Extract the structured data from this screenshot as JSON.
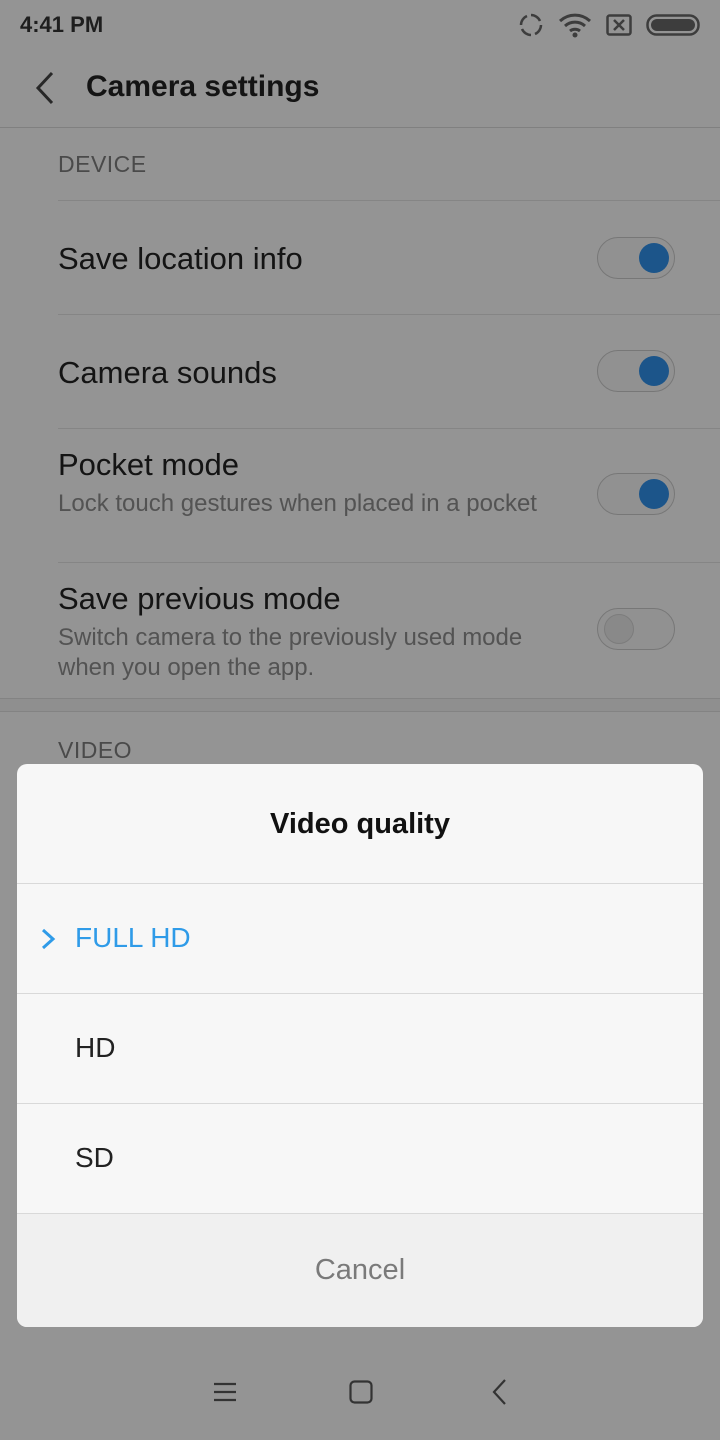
{
  "status_bar": {
    "time": "4:41 PM"
  },
  "app_bar": {
    "title": "Camera settings"
  },
  "device_section": {
    "header": "DEVICE",
    "items": [
      {
        "title": "Save location info",
        "subtitle": "",
        "enabled": true
      },
      {
        "title": "Camera sounds",
        "subtitle": "",
        "enabled": true
      },
      {
        "title": "Pocket mode",
        "subtitle": "Lock touch gestures when placed in a pocket",
        "enabled": true
      },
      {
        "title": "Save previous mode",
        "subtitle": "Switch camera to the previously used mode when you open the app.",
        "enabled": false
      }
    ]
  },
  "video_section": {
    "header": "VIDEO"
  },
  "dialog": {
    "title": "Video quality",
    "options": [
      {
        "label": "FULL HD",
        "selected": true
      },
      {
        "label": "HD",
        "selected": false
      },
      {
        "label": "SD",
        "selected": false
      }
    ],
    "cancel_label": "Cancel"
  },
  "colors": {
    "accent": "#2f9be8",
    "toggle_on": "#2f8ee6"
  }
}
